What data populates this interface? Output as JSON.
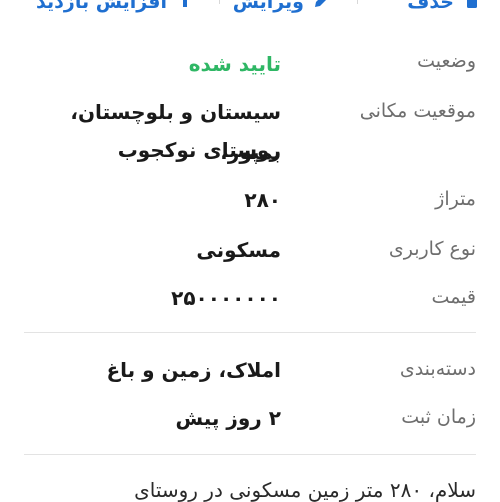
{
  "actions": {
    "delete_label": "حذف",
    "edit_label": "ویرایش",
    "bump_label": "افزایش بازدید"
  },
  "details_1": {
    "status_label": "وضعیت",
    "status_value": "تایید شده",
    "location_label": "موقعیت مکانی",
    "location_line1": "سیستان و بلوچستان، بمپور،",
    "location_line2": "روستای نوکجوب",
    "area_label": "متراژ",
    "area_value": "۲۸۰",
    "usage_label": "نوع کاربری",
    "usage_value": "مسکونی",
    "price_label": "قیمت",
    "price_value": "۲۵۰۰۰۰۰۰۰"
  },
  "details_2": {
    "category_label": "دسته‌بندی",
    "category_value": "املاک، زمین و باغ",
    "time_label": "زمان ثبت",
    "time_value": "۲ روز پیش"
  },
  "description": "سلام، ۲۸۰ متر زمین مسکونی در روستای",
  "colors": {
    "accent": "#1f6fd0",
    "status": "#2fb765",
    "label": "#6e6e6e"
  }
}
